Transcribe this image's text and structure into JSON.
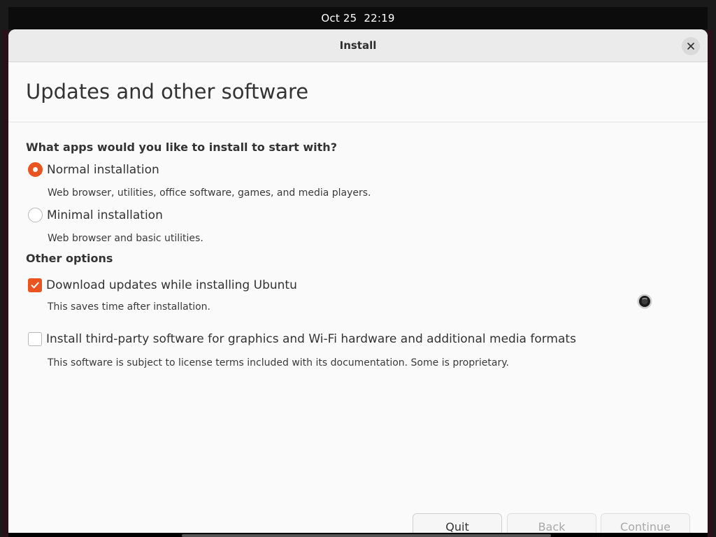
{
  "topbar": {
    "date": "Oct 25",
    "time": "22:19"
  },
  "window": {
    "title": "Install",
    "close_icon": "close-icon"
  },
  "page": {
    "title": "Updates and other software"
  },
  "apps_section": {
    "question": "What apps would you like to install to start with?",
    "options": [
      {
        "label": "Normal installation",
        "description": "Web browser, utilities, office software, games, and media players.",
        "selected": true
      },
      {
        "label": "Minimal installation",
        "description": "Web browser and basic utilities.",
        "selected": false
      }
    ]
  },
  "other_options": {
    "heading": "Other options",
    "items": [
      {
        "label": "Download updates while installing Ubuntu",
        "description": "This saves time after installation.",
        "checked": true
      },
      {
        "label": "Install third-party software for graphics and Wi-Fi hardware and additional media formats",
        "description": "This software is subject to license terms included with its documentation. Some is proprietary.",
        "checked": false
      }
    ]
  },
  "buttons": {
    "quit": "Quit",
    "back": "Back",
    "continue": "Continue"
  },
  "colors": {
    "accent": "#e95420",
    "window_bg": "#fafafa",
    "titlebar_bg": "#ebebeb",
    "topbar_bg": "#0c0c0c"
  },
  "icons": {
    "radio_selected": "radio-selected-icon",
    "checkbox_checked": "checkmark-icon",
    "cursor": "mouse-cursor-icon"
  }
}
